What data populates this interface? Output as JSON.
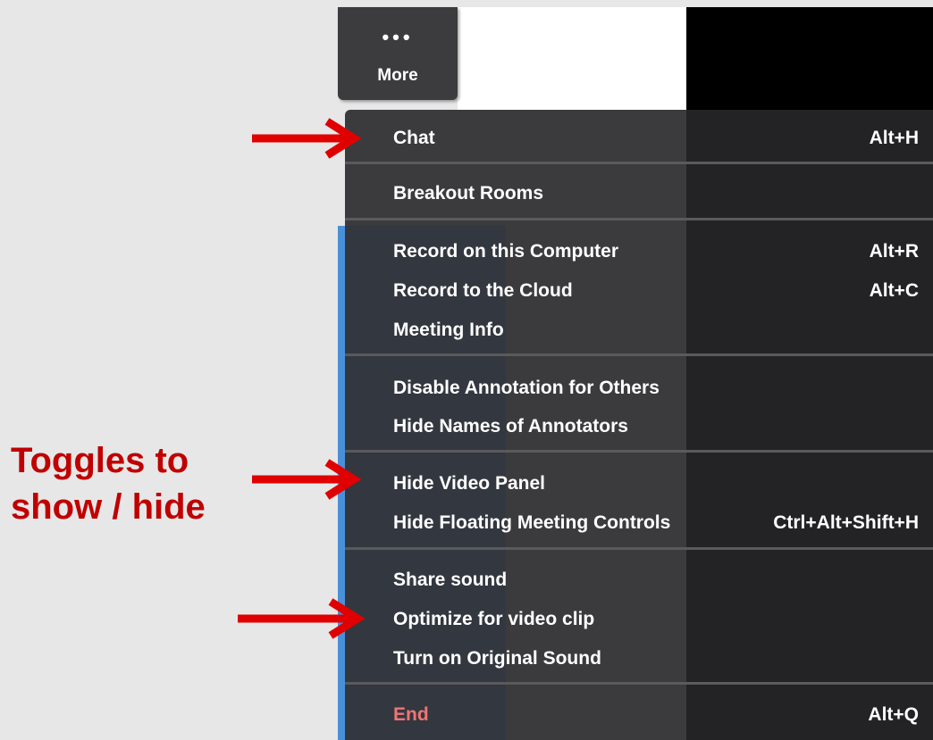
{
  "toolbar": {
    "more_dots": "•••",
    "more_label": "More"
  },
  "menu": {
    "items": [
      {
        "label": "Chat",
        "shortcut": "Alt+H"
      },
      {
        "label": "Breakout Rooms",
        "shortcut": ""
      },
      {
        "label": "Record on this Computer",
        "shortcut": "Alt+R"
      },
      {
        "label": "Record to the Cloud",
        "shortcut": "Alt+C"
      },
      {
        "label": "Meeting Info",
        "shortcut": ""
      },
      {
        "label": "Disable Annotation for Others",
        "shortcut": ""
      },
      {
        "label": "Hide Names of Annotators",
        "shortcut": ""
      },
      {
        "label": "Hide Video Panel",
        "shortcut": ""
      },
      {
        "label": "Hide Floating Meeting Controls",
        "shortcut": "Ctrl+Alt+Shift+H"
      },
      {
        "label": "Share sound",
        "shortcut": ""
      },
      {
        "label": "Optimize for video clip",
        "shortcut": ""
      },
      {
        "label": "Turn on Original Sound",
        "shortcut": ""
      },
      {
        "label": "End",
        "shortcut": "Alt+Q"
      }
    ]
  },
  "annotation": {
    "line1": "Toggles to",
    "line2": "show / hide",
    "color": "#c00000",
    "arrow_color": "#e00000"
  },
  "colors": {
    "menu_bg": "#3b3b3d",
    "end_text": "#f07575",
    "accent_blue": "#4a90d9"
  }
}
